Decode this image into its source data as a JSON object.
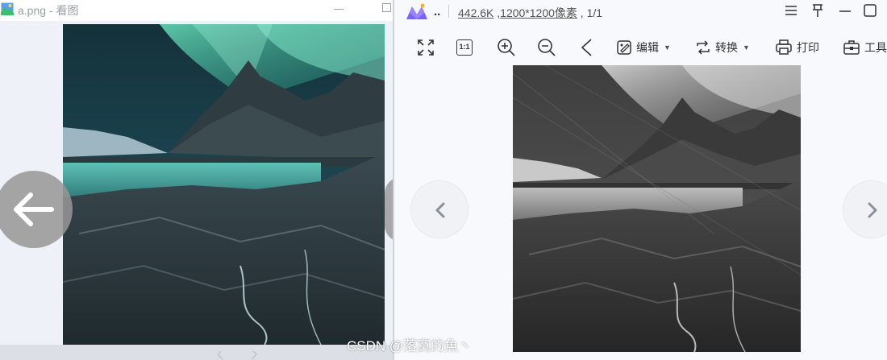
{
  "left_window": {
    "title": "a.png - 看图",
    "icons": {
      "app": "image-file-icon",
      "minimize": "minimize-icon",
      "maximize": "maximize-icon",
      "prev": "arrow-left-icon",
      "next": "chevron-right-icon"
    },
    "photo": "aurora-mountain-lake-color-photo"
  },
  "right_window": {
    "file_name": "..",
    "info": {
      "size": "442.6K",
      "dimensions": "1200*1200像素",
      "page": "1/1"
    },
    "window_buttons": [
      "menu-icon",
      "pin-icon",
      "minimize-icon",
      "maximize-icon"
    ],
    "toolbar": {
      "fullscreen_icon": "fullscreen-icon",
      "actual_size_label": "1:1",
      "zoom_in_icon": "zoom-in-icon",
      "zoom_out_icon": "zoom-out-icon",
      "rotate_icon": "chevron-left-icon",
      "edit_label": "编辑",
      "convert_label": "转换",
      "print_label": "打印",
      "tools_label": "工具"
    },
    "photo": "aurora-mountain-lake-grayscale-photo",
    "nav": {
      "prev_icon": "chevron-left-icon",
      "next_icon": "chevron-right-icon"
    }
  },
  "watermark": "CSDN @落寞的魚丶",
  "colors": {
    "accent": "#7b61ff",
    "toolbar_text": "#333333",
    "background": "#f7f9fd"
  }
}
